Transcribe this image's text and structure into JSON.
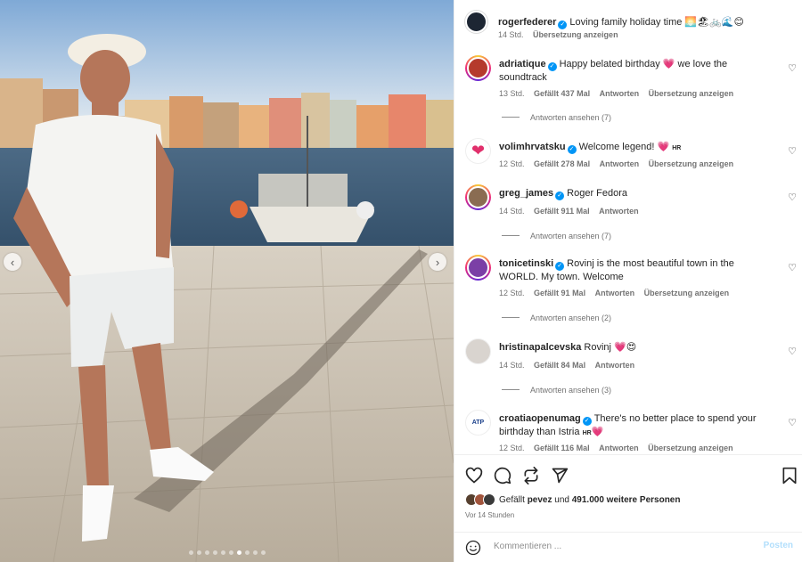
{
  "caption": {
    "username": "rogerfederer",
    "text": "Loving family holiday time 🌅🏖🚲🌊😊",
    "age": "14 Std.",
    "translate": "Übersetzung anzeigen"
  },
  "comments": [
    {
      "username": "adriatique",
      "text": "Happy belated birthday 💗 we love the soundtrack",
      "age": "13 Std.",
      "likes": "Gefällt 437 Mal",
      "reply": "Antworten",
      "translate": "Übersetzung anzeigen",
      "view_replies": "Antworten ansehen (7)"
    },
    {
      "username": "volimhrvatsku",
      "text": "Welcome legend! 💗",
      "flag": "HR",
      "age": "12 Std.",
      "likes": "Gefällt 278 Mal",
      "reply": "Antworten",
      "translate": "Übersetzung anzeigen"
    },
    {
      "username": "greg_james",
      "text": "Roger Fedora",
      "age": "14 Std.",
      "likes": "Gefällt 911 Mal",
      "reply": "Antworten",
      "view_replies": "Antworten ansehen (7)"
    },
    {
      "username": "tonicetinski",
      "text": "Rovinj is the most beautiful town in the WORLD. My town. Welcome",
      "age": "12 Std.",
      "likes": "Gefällt 91 Mal",
      "reply": "Antworten",
      "translate": "Übersetzung anzeigen",
      "view_replies": "Antworten ansehen (2)"
    },
    {
      "username": "hristinapalcevska",
      "text": "Rovinj 💗😍",
      "age": "14 Std.",
      "likes": "Gefällt 84 Mal",
      "reply": "Antworten",
      "view_replies": "Antworten ansehen (3)"
    },
    {
      "username": "croatiaopenumag",
      "text": "There's no better place to spend your birthday than Istria",
      "flag": "HR",
      "heart": "💗",
      "age": "12 Std.",
      "likes": "Gefällt 116 Mal",
      "reply": "Antworten",
      "translate": "Übersetzung anzeigen"
    }
  ],
  "likes": {
    "prefix": "Gefällt",
    "user": "pevez",
    "middle": "und",
    "count": "491.000 weitere Personen"
  },
  "posted": "Vor 14 Stunden",
  "comment_box": {
    "placeholder": "Kommentieren ...",
    "post": "Posten"
  },
  "icons": {
    "like": "heart-icon",
    "comment": "comment-icon",
    "share": "share-icon",
    "send": "send-icon",
    "save": "bookmark-icon",
    "emoji": "emoji-icon"
  },
  "colors": {
    "verified": "#0095f6",
    "link_blue": "#b2dffc",
    "text": "#262626",
    "muted": "#737373"
  }
}
